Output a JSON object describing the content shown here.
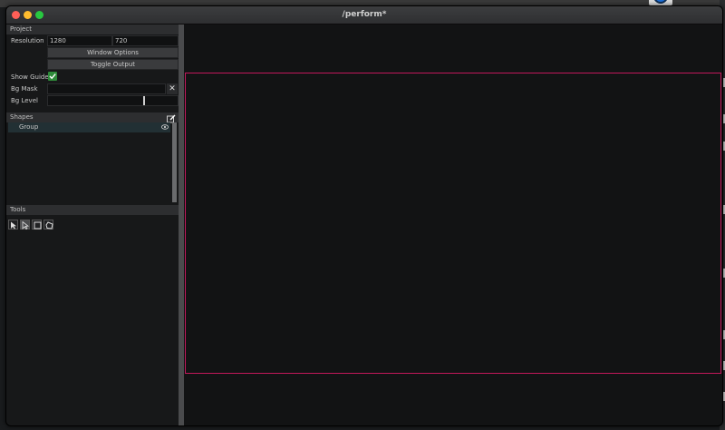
{
  "window": {
    "title": "/perform*"
  },
  "project": {
    "header": "Project",
    "resolution_label": "Resolution",
    "resolution_width": "1280",
    "resolution_height": "720",
    "window_options_label": "Window Options",
    "toggle_output_label": "Toggle Output",
    "show_guides_label": "Show Guides",
    "show_guides_checked": true,
    "bg_mask_label": "Bg Mask",
    "bg_level_label": "Bg Level",
    "bg_level_value": 0.73
  },
  "shapes": {
    "header": "Shapes",
    "items": [
      {
        "label": "Group",
        "visible": true
      }
    ]
  },
  "tools": {
    "header": "Tools",
    "items": [
      {
        "icon": "pointer-arrow-icon",
        "active": false
      },
      {
        "icon": "node-select-icon",
        "active": true
      },
      {
        "icon": "rectangle-icon",
        "active": false
      },
      {
        "icon": "polygon-icon",
        "active": false
      }
    ]
  },
  "colors": {
    "guide_border": "#c2185b",
    "checkbox": "#2e8b3a",
    "selected_row": "#223034"
  }
}
